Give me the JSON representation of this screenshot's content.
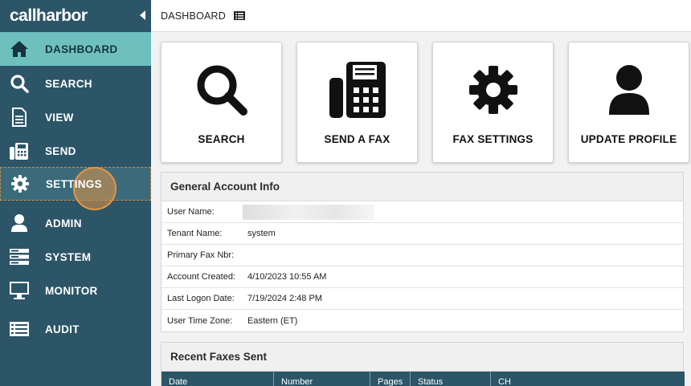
{
  "brand": {
    "logo_text": "callharbor"
  },
  "sidebar": {
    "items": [
      {
        "label": "DASHBOARD",
        "icon": "home-icon"
      },
      {
        "label": "SEARCH",
        "icon": "search-icon"
      },
      {
        "label": "VIEW",
        "icon": "document-icon"
      },
      {
        "label": "SEND",
        "icon": "fax-icon"
      },
      {
        "label": "SETTINGS",
        "icon": "gear-icon"
      },
      {
        "label": "ADMIN",
        "icon": "user-icon"
      },
      {
        "label": "SYSTEM",
        "icon": "server-icon"
      },
      {
        "label": "MONITOR",
        "icon": "monitor-icon"
      },
      {
        "label": "AUDIT",
        "icon": "list-icon"
      }
    ]
  },
  "header": {
    "breadcrumb": "DASHBOARD",
    "icon": "list-icon"
  },
  "tiles": [
    {
      "label": "SEARCH",
      "icon": "search-icon"
    },
    {
      "label": "SEND A FAX",
      "icon": "fax-icon"
    },
    {
      "label": "FAX SETTINGS",
      "icon": "gear-icon"
    },
    {
      "label": "UPDATE PROFILE",
      "icon": "user-icon"
    }
  ],
  "account_info": {
    "title": "General Account Info",
    "rows": [
      {
        "label": "User Name:",
        "value": ""
      },
      {
        "label": "Tenant Name:",
        "value": "system"
      },
      {
        "label": "Primary Fax Nbr:",
        "value": ""
      },
      {
        "label": "Account Created:",
        "value": "4/10/2023 10:55 AM"
      },
      {
        "label": "Last Logon Date:",
        "value": "7/19/2024 2:48 PM"
      },
      {
        "label": "User Time Zone:",
        "value": "Eastern (ET)"
      }
    ]
  },
  "recent_faxes": {
    "title": "Recent Faxes Sent",
    "columns": [
      "Date",
      "Number",
      "Pages",
      "Status",
      "CH"
    ]
  },
  "colors": {
    "sidebar": "#2c5567",
    "active": "#6ec0bf",
    "hover_ring": "#e39648"
  }
}
